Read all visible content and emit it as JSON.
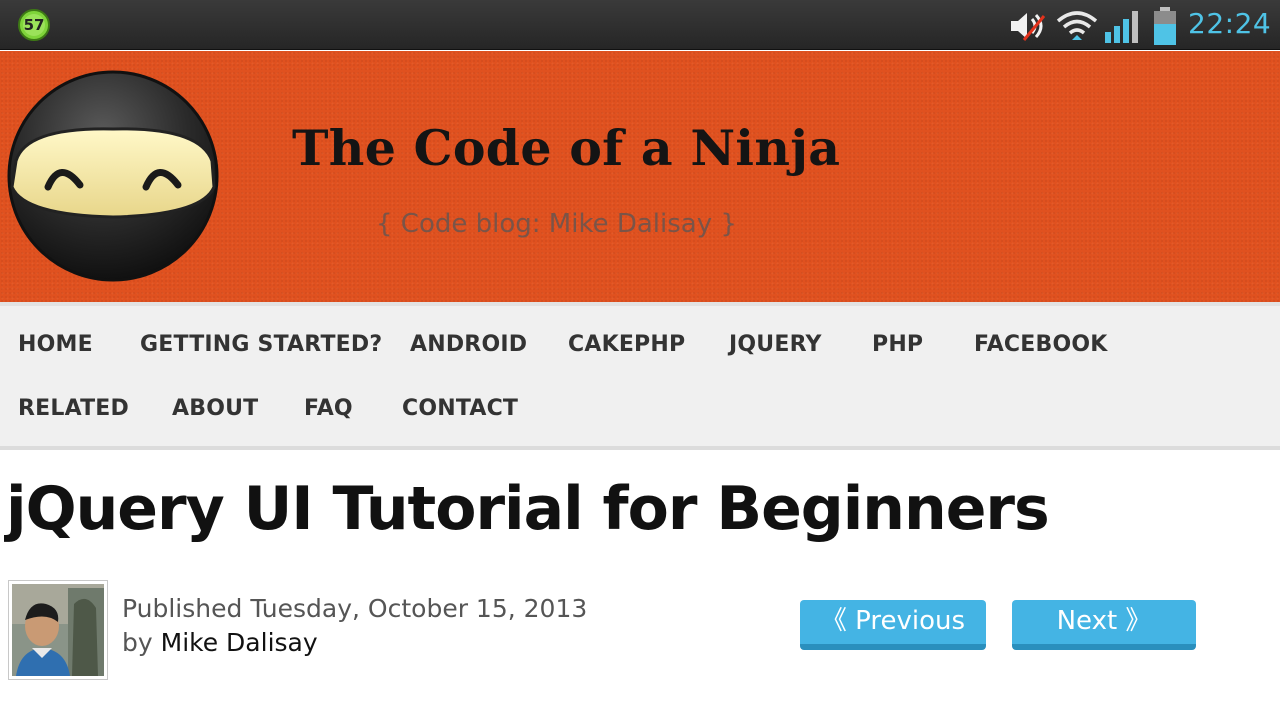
{
  "status_bar": {
    "notification_badge": "57",
    "time": "22:24",
    "icons": [
      "notification-badge-icon",
      "volume-muted-icon",
      "wifi-icon",
      "signal-icon",
      "battery-icon"
    ],
    "time_color": "#4fc3e6"
  },
  "header": {
    "title": "The Code of a Ninja",
    "subtitle": "{ Code blog: Mike Dalisay }",
    "background_color": "#e0511f",
    "logo_icon": "ninja-logo-icon"
  },
  "nav": {
    "items": [
      {
        "label": "HOME"
      },
      {
        "label": "GETTING STARTED?"
      },
      {
        "label": "ANDROID"
      },
      {
        "label": "CAKEPHP"
      },
      {
        "label": "JQUERY"
      },
      {
        "label": "PHP"
      },
      {
        "label": "FACEBOOK"
      },
      {
        "label": "RELATED"
      },
      {
        "label": "ABOUT"
      },
      {
        "label": "FAQ"
      },
      {
        "label": "CONTACT"
      }
    ]
  },
  "post": {
    "title": "jQuery UI Tutorial for Beginners",
    "published_prefix": "Published",
    "published_date": "Tuesday, October 15, 2013",
    "by_prefix": "by",
    "author": "Mike Dalisay",
    "prev_label": "《 Previous",
    "next_label": "Next 》",
    "button_color": "#44b4e4"
  }
}
